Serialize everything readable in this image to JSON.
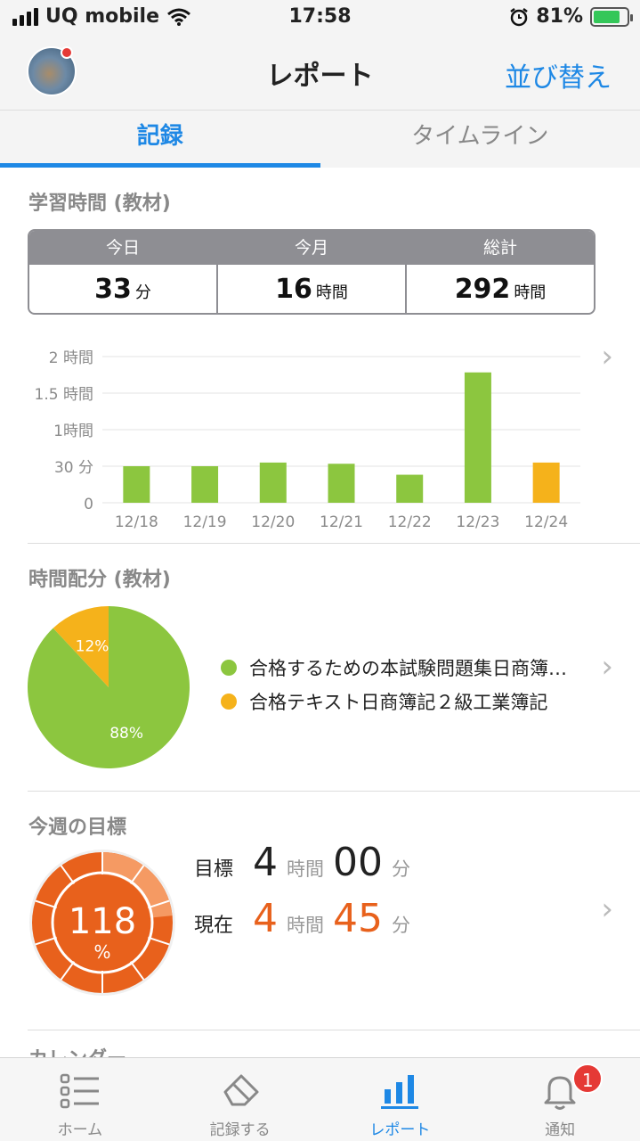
{
  "status_bar": {
    "carrier": "UQ mobile",
    "time": "17:58",
    "battery": "81%"
  },
  "header": {
    "title": "レポート",
    "sort_label": "並び替え"
  },
  "tabs": [
    {
      "label": "記録",
      "active": true
    },
    {
      "label": "タイムライン",
      "active": false
    }
  ],
  "study_time": {
    "title": "学習時間 (教材)",
    "stats": [
      {
        "label": "今日",
        "value": "33",
        "unit": "分"
      },
      {
        "label": "今月",
        "value": "16",
        "unit": "時間"
      },
      {
        "label": "総計",
        "value": "292",
        "unit": "時間"
      }
    ]
  },
  "chart_data": {
    "type": "bar",
    "categories": [
      "12/18",
      "12/19",
      "12/20",
      "12/21",
      "12/22",
      "12/23",
      "12/24"
    ],
    "values": [
      30,
      30,
      33,
      32,
      23,
      107,
      33
    ],
    "value_unit": "minutes",
    "bar_colors": [
      "#8cc63f",
      "#8cc63f",
      "#8cc63f",
      "#8cc63f",
      "#8cc63f",
      "#8cc63f",
      "#f5b21b"
    ],
    "y_ticks": [
      {
        "value": 0,
        "label": "0"
      },
      {
        "value": 30,
        "label": "30 分"
      },
      {
        "value": 60,
        "label": "1時間"
      },
      {
        "value": 90,
        "label": "1.5 時間"
      },
      {
        "value": 120,
        "label": "2 時間"
      }
    ],
    "ylim": [
      0,
      120
    ],
    "grid": true
  },
  "allocation": {
    "title": "時間配分 (教材)",
    "slices": [
      {
        "label": "88%",
        "percent": 88,
        "color": "#8cc63f",
        "name": "合格するための本試験問題集日商簿…"
      },
      {
        "label": "12%",
        "percent": 12,
        "color": "#f5b21b",
        "name": "合格テキスト日商簿記２級工業簿記"
      }
    ]
  },
  "weekly_goal": {
    "title": "今週の目標",
    "percent": "118",
    "percent_sign": "%",
    "progress_fraction": 1.18,
    "target_label": "目標",
    "target_hours": "4",
    "target_minutes": "00",
    "current_label": "現在",
    "current_hours": "4",
    "current_minutes": "45",
    "hour_unit": "時間",
    "minute_unit": "分"
  },
  "next_section_peek": "カレンダー",
  "tab_bar": {
    "items": [
      {
        "label": "ホーム",
        "icon": "list-icon"
      },
      {
        "label": "記録する",
        "icon": "eraser-icon"
      },
      {
        "label": "レポート",
        "icon": "bar-chart-icon"
      },
      {
        "label": "通知",
        "icon": "bell-icon"
      }
    ],
    "badge": "1"
  },
  "colors": {
    "accent": "#1e88e5",
    "green": "#8cc63f",
    "yellow": "#f5b21b",
    "orange": "#e8611c",
    "badge": "#e53935"
  }
}
